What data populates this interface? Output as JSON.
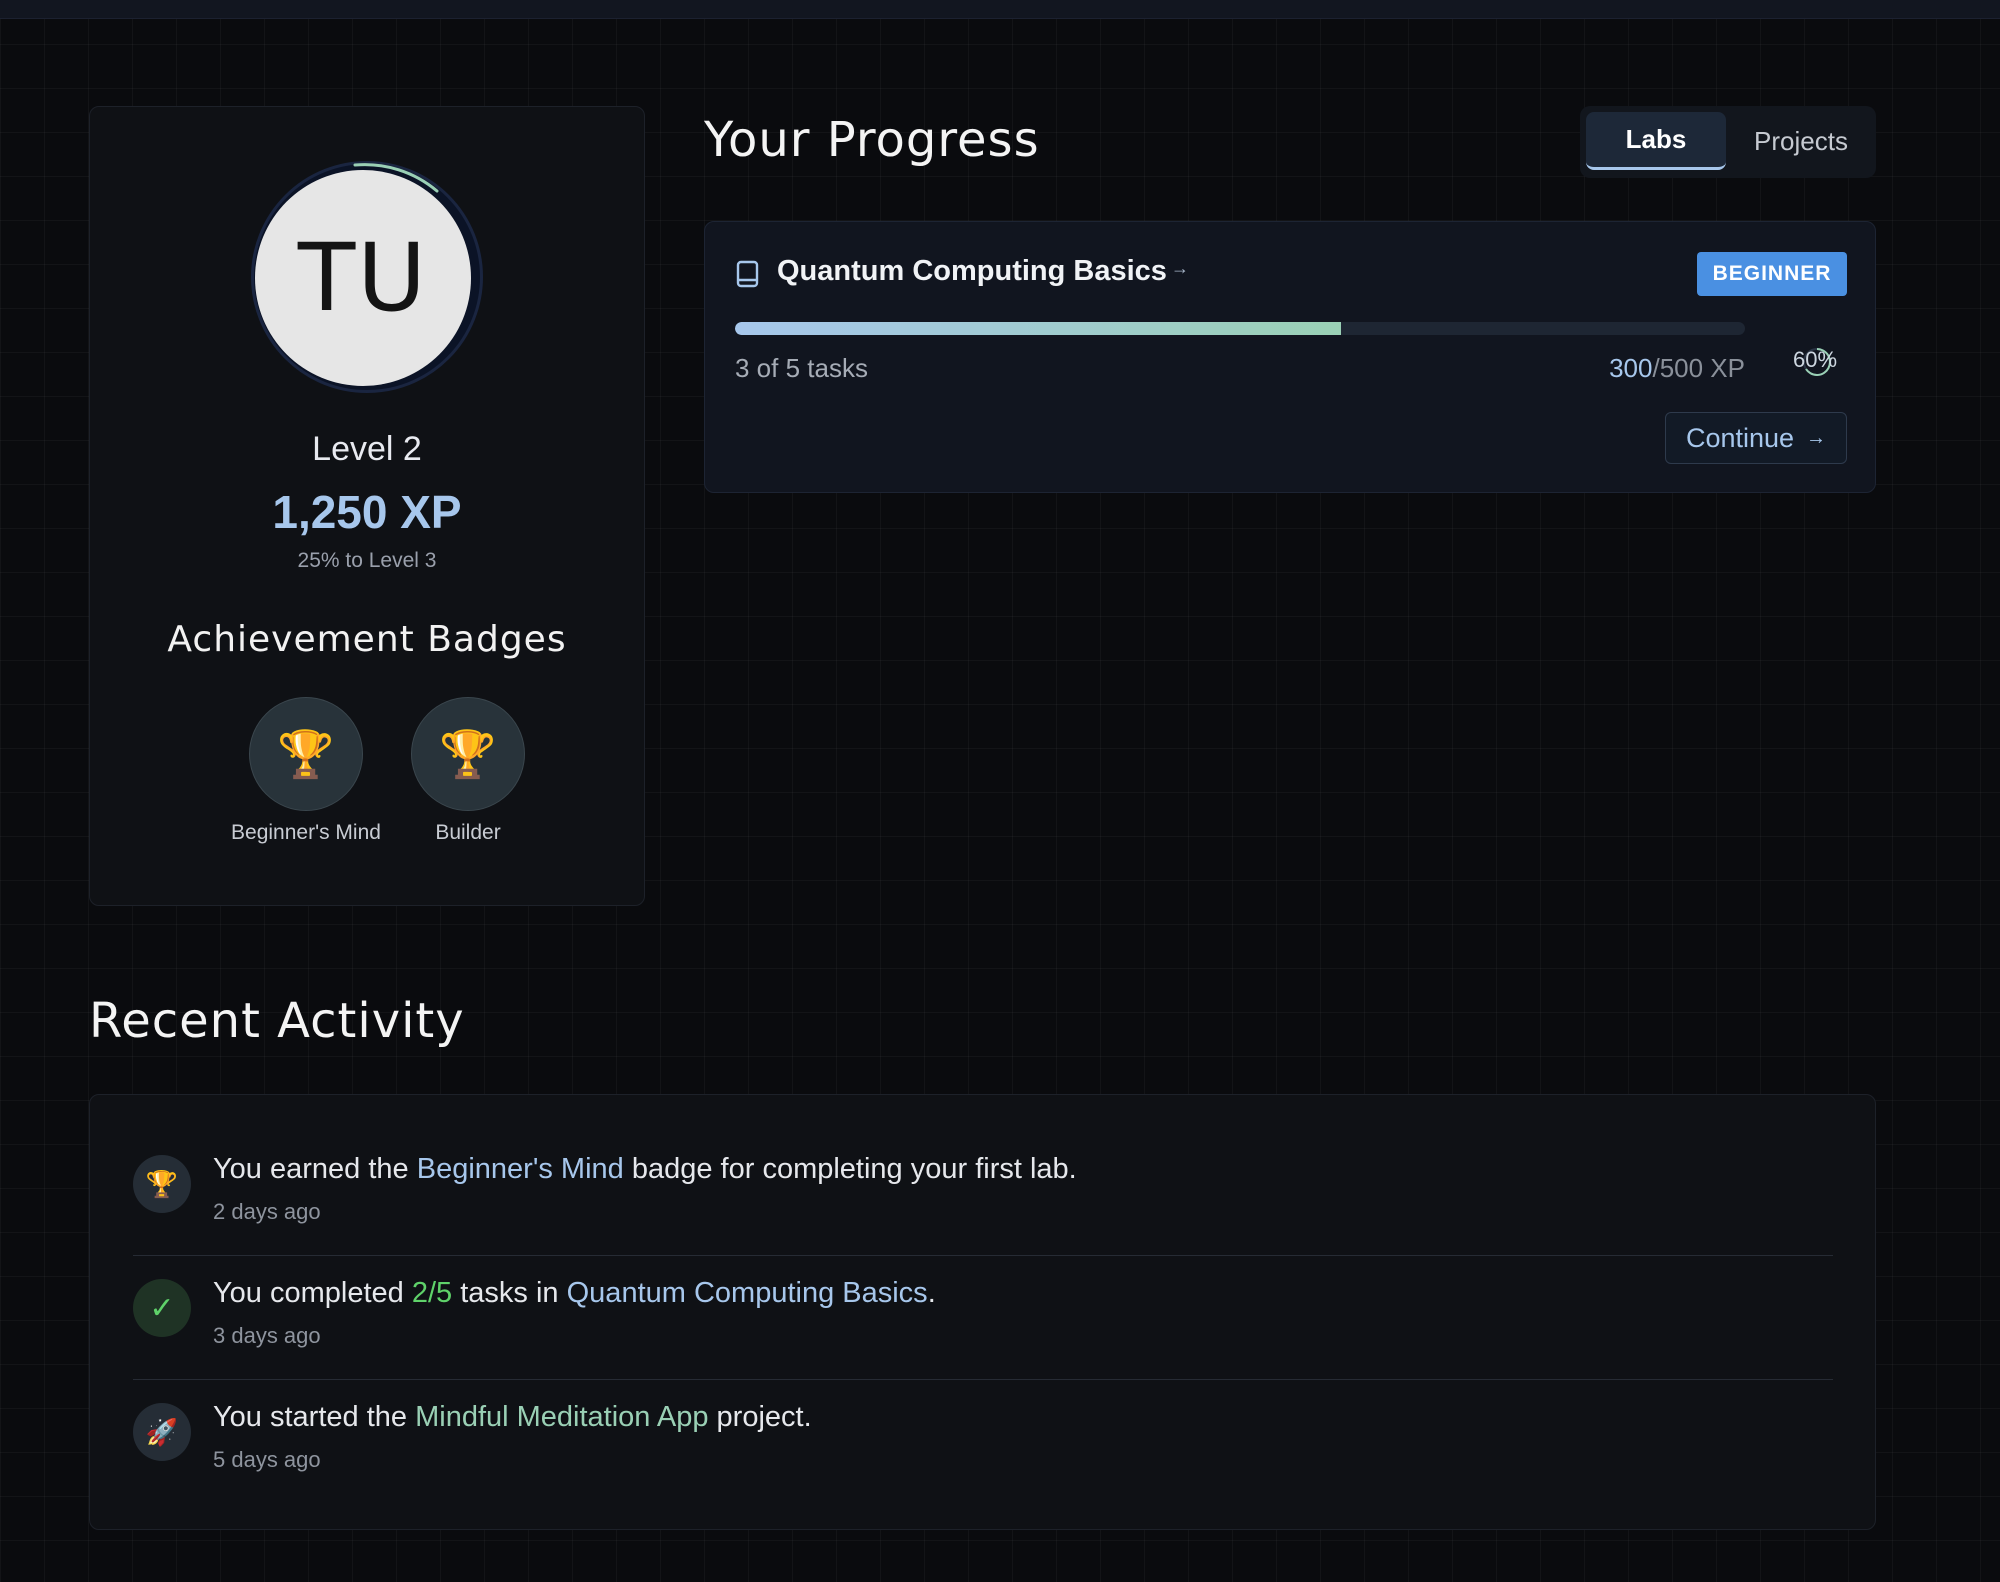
{
  "profile": {
    "initials": "TU",
    "level_label": "Level 2",
    "xp": "1,250 XP",
    "to_next": "25% to Level 3",
    "badges_title": "Achievement Badges",
    "badges": [
      {
        "icon": "trophy-icon",
        "glyph": "🏆",
        "label": "Beginner's Mind"
      },
      {
        "icon": "trophy-icon",
        "glyph": "🏆",
        "label": "Builder"
      }
    ]
  },
  "progress": {
    "title": "Your Progress",
    "tabs": [
      {
        "label": "Labs",
        "active": true
      },
      {
        "label": "Projects",
        "active": false
      }
    ],
    "lab": {
      "title": "Quantum Computing Basics",
      "arrow": "→",
      "level": "BEGINNER",
      "tasks": "3 of 5 tasks",
      "xp_current": "300",
      "xp_total": "/500 XP",
      "percent_label": "60%",
      "progress_fraction": 0.6,
      "continue_label": "Continue",
      "continue_arrow": "→"
    }
  },
  "activity": {
    "title": "Recent Activity",
    "items": [
      {
        "icon": "trophy-icon",
        "glyph": "🏆",
        "pre": "You earned the ",
        "highlight": "Beginner's Mind",
        "post": " badge for completing your first lab.",
        "time": "2 days ago"
      },
      {
        "icon": "check-icon",
        "glyph": "✓",
        "pre": "You completed ",
        "highlight_count": "2/5",
        "mid": " tasks in ",
        "highlight": "Quantum Computing Basics",
        "post": ".",
        "time": "3 days ago"
      },
      {
        "icon": "rocket-icon",
        "glyph": "🚀",
        "pre": "You started the ",
        "highlight": "Mindful Meditation App",
        "post": " project.",
        "time": "5 days ago"
      }
    ]
  },
  "colors": {
    "accent": "#a7c7ec",
    "success": "#5fd26a",
    "mint": "#9ad0b5",
    "badge_blue": "#4a90e2",
    "background": "#0a0b0e"
  }
}
